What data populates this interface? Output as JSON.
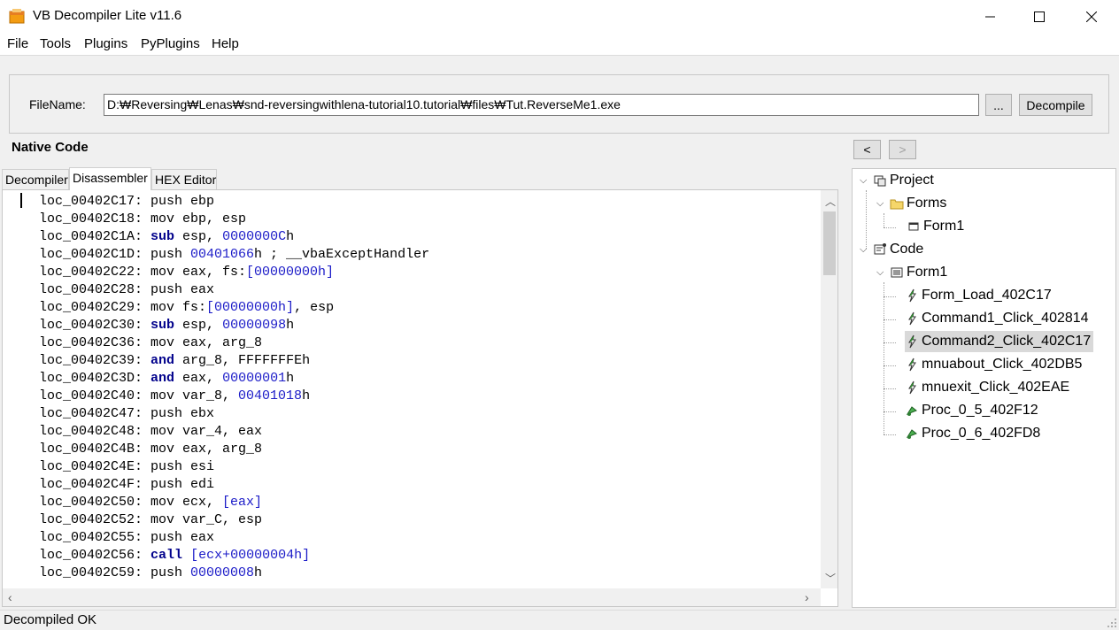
{
  "window": {
    "title": "VB Decompiler Lite v11.6"
  },
  "menu": [
    "File",
    "Tools",
    "Plugins",
    "PyPlugins",
    "Help"
  ],
  "file": {
    "label": "FileName:",
    "path": "D:₩Reversing₩Lenas₩snd-reversingwithlena-tutorial10.tutorial₩files₩Tut.ReverseMe1.exe",
    "browse_label": "...",
    "decompile_label": "Decompile"
  },
  "section_title": "Native Code",
  "nav": {
    "back": "<",
    "forward": ">"
  },
  "tabs": [
    "Decompiler",
    "Disassembler",
    "HEX Editor"
  ],
  "active_tab": "Disassembler",
  "code_lines": [
    [
      [
        "t",
        "loc_00402C17: push ebp"
      ]
    ],
    [
      [
        "t",
        "loc_00402C18: mov ebp, esp"
      ]
    ],
    [
      [
        "t",
        "loc_00402C1A: "
      ],
      [
        "k",
        "sub"
      ],
      [
        "t",
        " esp, "
      ],
      [
        "n",
        "0000000C"
      ],
      [
        "t",
        "h"
      ]
    ],
    [
      [
        "t",
        "loc_00402C1D: push "
      ],
      [
        "n",
        "00401066"
      ],
      [
        "t",
        "h ; __vbaExceptHandler"
      ]
    ],
    [
      [
        "t",
        "loc_00402C22: mov eax, fs:"
      ],
      [
        "n",
        "[00000000h]"
      ]
    ],
    [
      [
        "t",
        "loc_00402C28: push eax"
      ]
    ],
    [
      [
        "t",
        "loc_00402C29: mov fs:"
      ],
      [
        "n",
        "[00000000h]"
      ],
      [
        "t",
        ", esp"
      ]
    ],
    [
      [
        "t",
        "loc_00402C30: "
      ],
      [
        "k",
        "sub"
      ],
      [
        "t",
        " esp, "
      ],
      [
        "n",
        "00000098"
      ],
      [
        "t",
        "h"
      ]
    ],
    [
      [
        "t",
        "loc_00402C36: mov eax, arg_8"
      ]
    ],
    [
      [
        "t",
        "loc_00402C39: "
      ],
      [
        "k",
        "and"
      ],
      [
        "t",
        " arg_8, FFFFFFFEh"
      ]
    ],
    [
      [
        "t",
        "loc_00402C3D: "
      ],
      [
        "k",
        "and"
      ],
      [
        "t",
        " eax, "
      ],
      [
        "n",
        "00000001"
      ],
      [
        "t",
        "h"
      ]
    ],
    [
      [
        "t",
        "loc_00402C40: mov var_8, "
      ],
      [
        "n",
        "00401018"
      ],
      [
        "t",
        "h"
      ]
    ],
    [
      [
        "t",
        "loc_00402C47: push ebx"
      ]
    ],
    [
      [
        "t",
        "loc_00402C48: mov var_4, eax"
      ]
    ],
    [
      [
        "t",
        "loc_00402C4B: mov eax, arg_8"
      ]
    ],
    [
      [
        "t",
        "loc_00402C4E: push esi"
      ]
    ],
    [
      [
        "t",
        "loc_00402C4F: push edi"
      ]
    ],
    [
      [
        "t",
        "loc_00402C50: mov ecx, "
      ],
      [
        "n",
        "[eax]"
      ]
    ],
    [
      [
        "t",
        "loc_00402C52: mov var_C, esp"
      ]
    ],
    [
      [
        "t",
        "loc_00402C55: push eax"
      ]
    ],
    [
      [
        "t",
        "loc_00402C56: "
      ],
      [
        "k",
        "call"
      ],
      [
        "t",
        " "
      ],
      [
        "n",
        "[ecx+00000004h]"
      ]
    ],
    [
      [
        "t",
        "loc_00402C59: push "
      ],
      [
        "n",
        "00000008"
      ],
      [
        "t",
        "h"
      ]
    ]
  ],
  "tree": {
    "project": "Project",
    "forms": "Forms",
    "form1_form": "Form1",
    "code": "Code",
    "form1_code": "Form1",
    "items": [
      {
        "label": "Form_Load_402C17",
        "icon": "event-icon"
      },
      {
        "label": "Command1_Click_402814",
        "icon": "event-icon"
      },
      {
        "label": "Command2_Click_402C17",
        "icon": "event-icon",
        "selected": true
      },
      {
        "label": "mnuabout_Click_402DB5",
        "icon": "event-icon"
      },
      {
        "label": "mnuexit_Click_402EAE",
        "icon": "event-icon"
      },
      {
        "label": "Proc_0_5_402F12",
        "icon": "procedure-icon"
      },
      {
        "label": "Proc_0_6_402FD8",
        "icon": "procedure-icon"
      }
    ]
  },
  "status": "Decompiled OK",
  "colors": {
    "keyword": "#00008b",
    "number": "#1c1cc8",
    "selected": "#d9d9d9"
  }
}
